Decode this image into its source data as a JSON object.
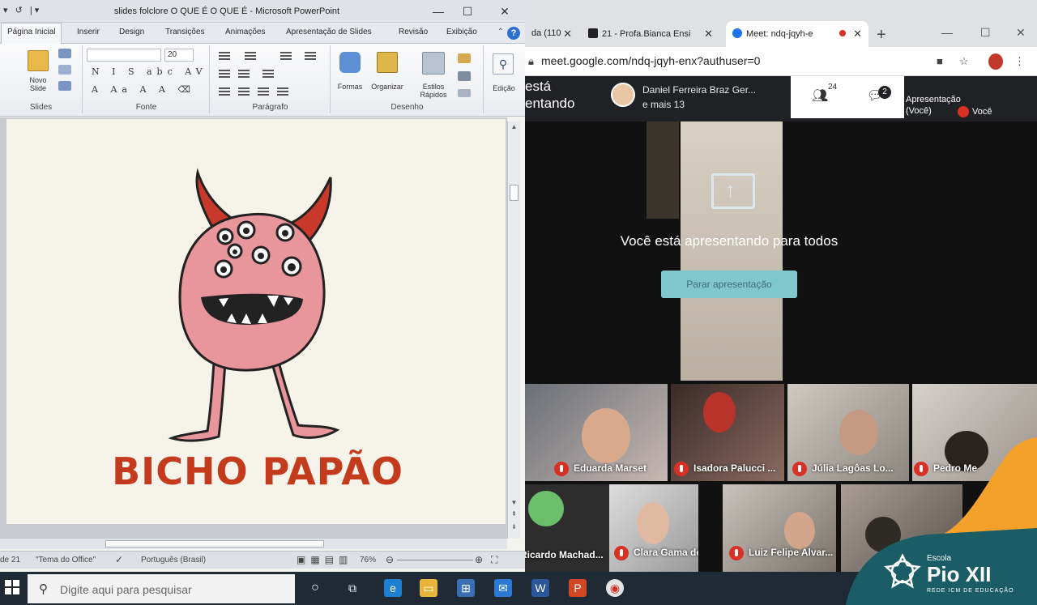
{
  "powerpoint": {
    "qat": "▾ ↺ |▾",
    "title": "slides folclore O QUE É O QUE É  -  Microsoft PowerPoint",
    "window_controls": {
      "minimize": "—",
      "maximize": "☐",
      "close": "✕"
    },
    "tabs": [
      "Página Inicial",
      "Inserir",
      "Design",
      "Transições",
      "Animações",
      "Apresentação de Slides",
      "Revisão",
      "Exibição"
    ],
    "ribbon": {
      "new_slide": "Novo\nSlide",
      "groups": [
        "Slides",
        "Fonte",
        "Parágrafo",
        "Desenho"
      ],
      "font_size": "20",
      "font_buttons": "N I S abc AV",
      "shapes": "Formas",
      "arrange": "Organizar",
      "quick_styles": "Estilos\nRápidos",
      "edit": "Edição"
    },
    "slide": {
      "title": "BICHO PAPÃO"
    },
    "status": {
      "slide": "de 21",
      "theme": "\"Tema do Office\"",
      "language": "Português (Brasil)",
      "zoom": "76%"
    }
  },
  "chrome": {
    "tabs": [
      {
        "label": "da (110",
        "active": false
      },
      {
        "label": "21 - Profa.Bianca Ensi",
        "active": false
      },
      {
        "label": "Meet: ndq-jqyh-e",
        "active": true
      }
    ],
    "new_tab": "+",
    "url": "meet.google.com/ndq-jqyh-enx?authuser=0"
  },
  "meet": {
    "presenting_label": "está\nentando",
    "presenter_names": "Daniel Ferreira Braz Ger...\ne mais 13",
    "participants_count": "24",
    "chat_count": "2",
    "presentation_label": "Apresentação\n(Você)",
    "you_label": "Você",
    "share_message": "Você está apresentando para todos",
    "stop_button": "Parar apresentação",
    "participants": [
      "Eduarda Marset",
      "Isadora Palucci ...",
      "Júlia Lagôas Lo...",
      "Pedro Me",
      "Ricardo Machad...",
      "Clara Gama de ...",
      "Luiz Felipe Alvar..."
    ]
  },
  "taskbar": {
    "search_placeholder": "Digite aqui para pesquisar"
  },
  "logo": {
    "small": "Escola",
    "name": "Pio XII",
    "network": "REDE ICM DE EDUCAÇÃO"
  },
  "colors": {
    "slide_title": "#c43a1c",
    "monster_body": "#e8959b",
    "meet_bg": "#202124",
    "logo_teal": "#1b5d67",
    "logo_orange": "#f3a12b",
    "stop_button": "#7fc7cd"
  }
}
